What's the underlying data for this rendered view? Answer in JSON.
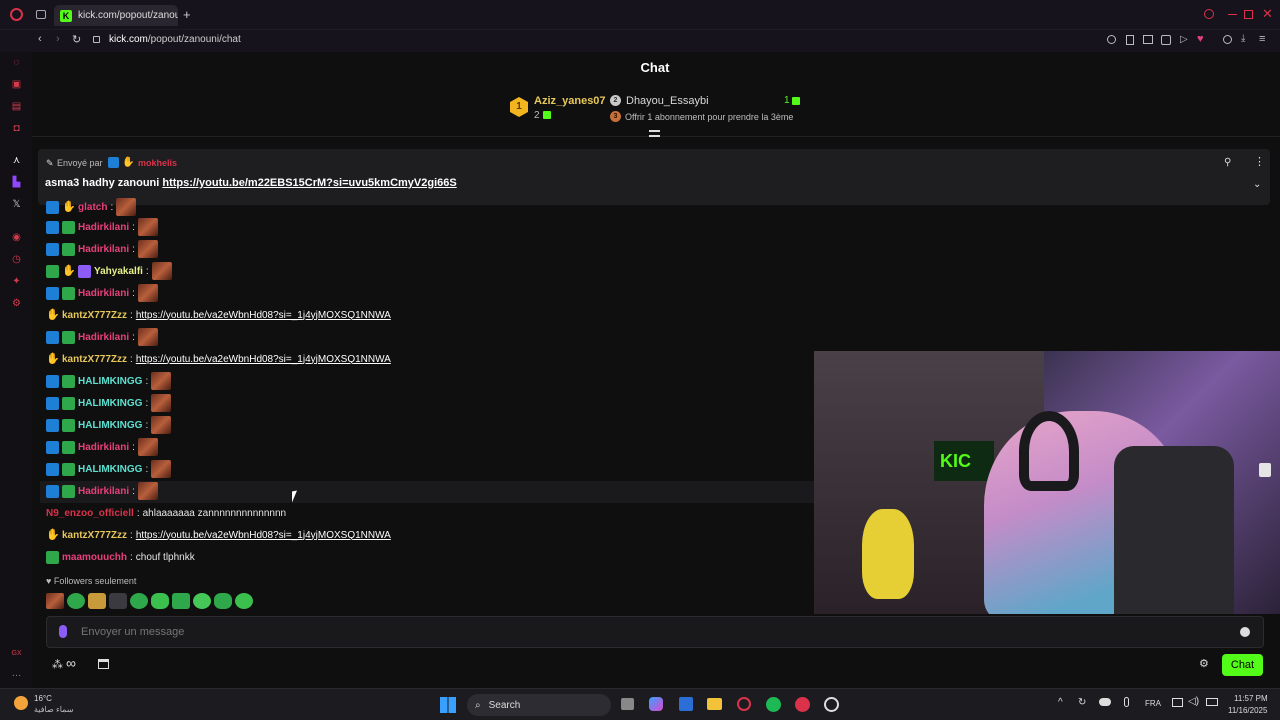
{
  "browser": {
    "tab_title": "kick.com/popout/zanouni",
    "tab_icon": "kick-icon",
    "url_domain": "kick.com",
    "url_path": "/popout/zanouni/chat"
  },
  "chat": {
    "title": "Chat",
    "leaderboard": {
      "first": {
        "rank": "1",
        "name": "Aziz_yanes07",
        "count": "2"
      },
      "second": {
        "rank": "2",
        "name": "Dhayou_Essaybi",
        "count": "1"
      },
      "third": {
        "rank": "3",
        "text": "Offrir 1 abonnement pour prendre la 3ème"
      }
    },
    "pinned": {
      "sent_by": "Envoyé par",
      "sender": "mokhelis",
      "text": "asma3 hadhy zanouni",
      "link": "https://youtu.be/m22EBS15CrM?si=uvu5kmCmyV2gi66S"
    },
    "messages": [
      {
        "user": "glatch",
        "text": ""
      },
      {
        "user": "Hadirkilani",
        "text": ""
      },
      {
        "user": "Hadirkilani",
        "text": ""
      },
      {
        "user": "Yahyakalfi",
        "text": ""
      },
      {
        "user": "Hadirkilani",
        "text": ""
      },
      {
        "user": "kantzX777Zzz",
        "text": "https://youtu.be/va2eWbnHd08?si=_1j4yjMOXSQ1NNWA"
      },
      {
        "user": "Hadirkilani",
        "text": ""
      },
      {
        "user": "kantzX777Zzz",
        "text": "https://youtu.be/va2eWbnHd08?si=_1j4yjMOXSQ1NNWA"
      },
      {
        "user": "HALIMKINGG",
        "text": ""
      },
      {
        "user": "HALIMKINGG",
        "text": ""
      },
      {
        "user": "HALIMKINGG",
        "text": ""
      },
      {
        "user": "Hadirkilani",
        "text": ""
      },
      {
        "user": "HALIMKINGG",
        "text": ""
      },
      {
        "user": "Hadirkilani",
        "text": ""
      },
      {
        "user": "N9_enzoo_officiell",
        "text": "ahlaaaaaaa zannnnnnnnnnnnnn"
      },
      {
        "user": "kantzX777Zzz",
        "text": "https://youtu.be/va2eWbnHd08?si=_1j4yjMOXSQ1NNWA"
      },
      {
        "user": "maamouuchh",
        "text": "chouf tlphnkk"
      }
    ],
    "followers_only": "Followers seulement",
    "input_placeholder": "Envoyer un message",
    "send_button": "Chat"
  },
  "taskbar": {
    "weather_temp": "16°C",
    "weather_desc": "سماء صافية",
    "search_label": "Search",
    "lang": "FRA",
    "time": "11:57 PM",
    "date": "11/16/2025"
  },
  "colors": {
    "kick_green": "#53fc18",
    "user_pink": "#e8407a",
    "user_yellow": "#e7c85a",
    "user_cyan": "#5ee0d0",
    "user_red": "#d9324a",
    "user_green_light": "#a8e65a"
  }
}
